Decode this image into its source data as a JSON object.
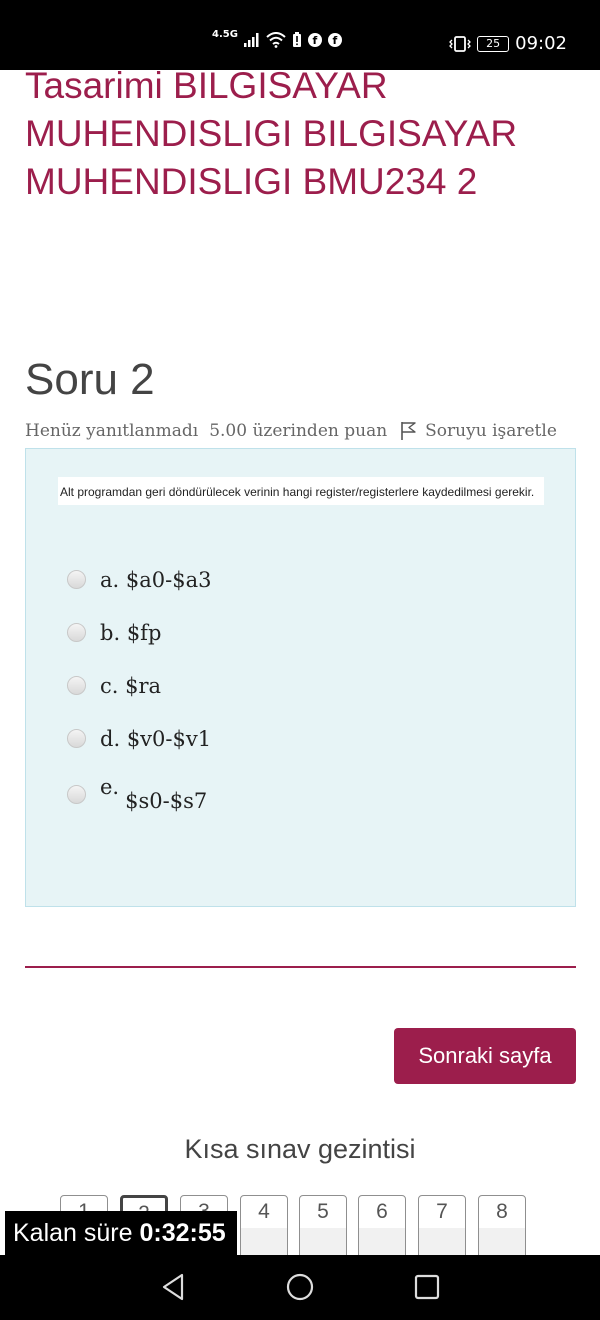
{
  "status_bar": {
    "network": "4.5G",
    "battery": "25",
    "time": "09:02",
    "icons": [
      "signal-icon",
      "wifi-icon",
      "battery-alert-icon",
      "facebook-icon",
      "facebook-icon",
      "vibrate-icon",
      "battery-icon"
    ]
  },
  "page": {
    "course_title": "Tasarimi BILGISAYAR MUHENDISLIGI BILGISAYAR MUHENDISLIGI BMU234 2"
  },
  "question": {
    "heading": "Soru 2",
    "status": "Henüz yanıtlanmadı",
    "points": "5.00 üzerinden puan",
    "flag_label": "Soruyu işaretle",
    "text": "Alt programdan geri döndürülecek verinin hangi register/registerlere kaydedilmesi gerekir.",
    "options": [
      {
        "letter": "a.",
        "text": "$a0-$a3"
      },
      {
        "letter": "b.",
        "text": "$fp"
      },
      {
        "letter": "c.",
        "text": "$ra"
      },
      {
        "letter": "d.",
        "text": "$v0-$v1"
      },
      {
        "letter": "e.",
        "text": "$s0-$s7"
      }
    ]
  },
  "next_button": "Sonraki sayfa",
  "quiz_nav": {
    "title": "Kısa sınav gezintisi",
    "items": [
      "1",
      "2",
      "3",
      "4",
      "5",
      "6",
      "7",
      "8"
    ],
    "current": "2"
  },
  "timer": {
    "label": "Kalan süre",
    "value": "0:32:55"
  },
  "colors": {
    "accent": "#9c1e4c",
    "question_bg": "#e7f4f6"
  }
}
